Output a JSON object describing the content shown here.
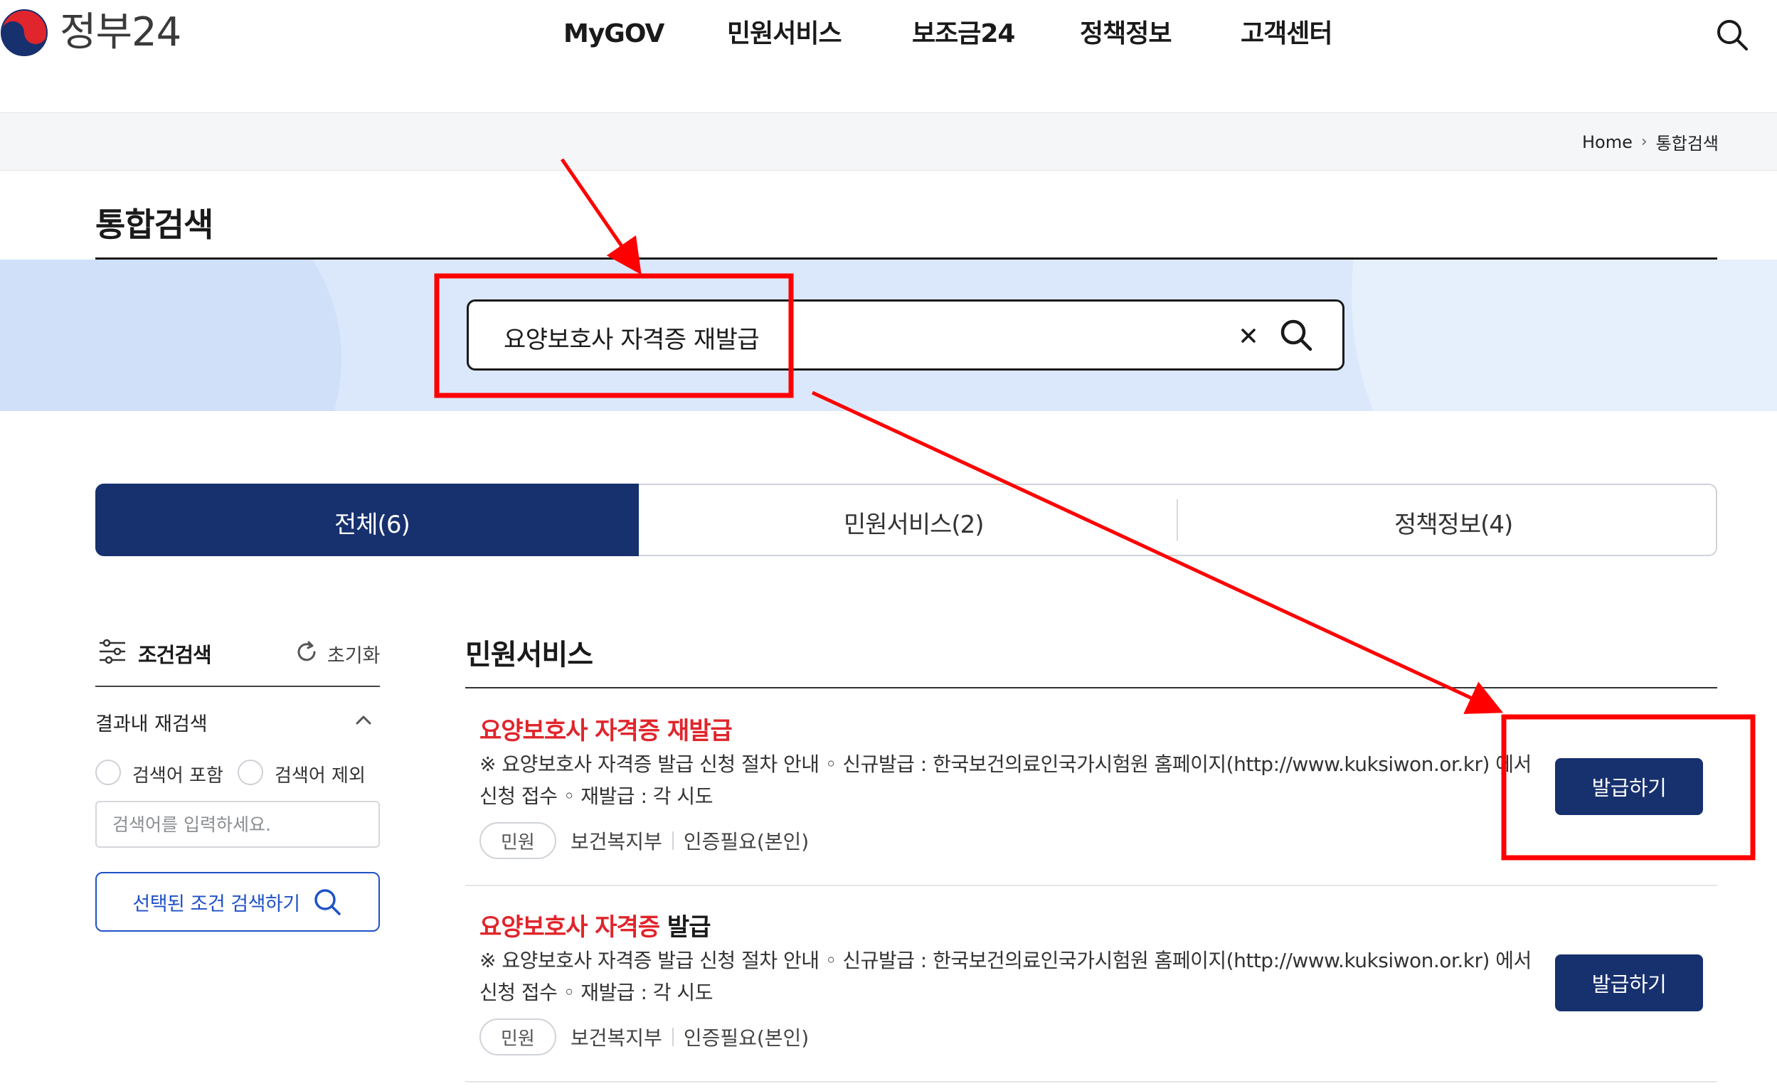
{
  "header": {
    "logo_text": "정부24",
    "nav": [
      "MyGOV",
      "민원서비스",
      "보조금24",
      "정책정보",
      "고객센터"
    ]
  },
  "breadcrumb": {
    "home": "Home",
    "current": "통합검색"
  },
  "page": {
    "title": "통합검색"
  },
  "search": {
    "query": "요양보호사 자격증 재발급"
  },
  "tabs": [
    {
      "label": "전체(6)",
      "active": true
    },
    {
      "label": "민원서비스(2)",
      "active": false
    },
    {
      "label": "정책정보(4)",
      "active": false
    }
  ],
  "sidebar": {
    "filter_label": "조건검색",
    "reset_label": "초기화",
    "refine_label": "결과내 재검색",
    "include_label": "검색어 포함",
    "exclude_label": "검색어 제외",
    "input_placeholder": "검색어를 입력하세요.",
    "condition_button": "선택된 조건 검색하기"
  },
  "results": {
    "section_title": "민원서비스",
    "items": [
      {
        "title_highlight": "요양보호사 자격증 재발급",
        "title_rest": "",
        "desc": "※ 요양보호사 자격증 발급 신청 절차 안내 ◦ 신규발급 : 한국보건의료인국가시험원 홈페이지(http://www.kuksiwon.or.kr) 에서 신청 접수 ◦ 재발급 : 각 시도",
        "tag": "민원",
        "dept": "보건복지부",
        "auth": "인증필요(본인)",
        "button": "발급하기"
      },
      {
        "title_highlight": "요양보호사 자격증",
        "title_rest": " 발급",
        "desc": "※ 요양보호사 자격증 발급 신청 절차 안내 ◦ 신규발급 : 한국보건의료인국가시험원 홈페이지(http://www.kuksiwon.or.kr) 에서 신청 접수 ◦ 재발급 : 각 시도",
        "tag": "민원",
        "dept": "보건복지부",
        "auth": "인증필요(본인)",
        "button": "발급하기"
      }
    ]
  },
  "colors": {
    "primary_navy": "#17306e",
    "highlight_red": "#e0252c",
    "annotation_red": "#ff0000",
    "search_band": "#dbe8fb",
    "outline_blue": "#1f52c8"
  }
}
